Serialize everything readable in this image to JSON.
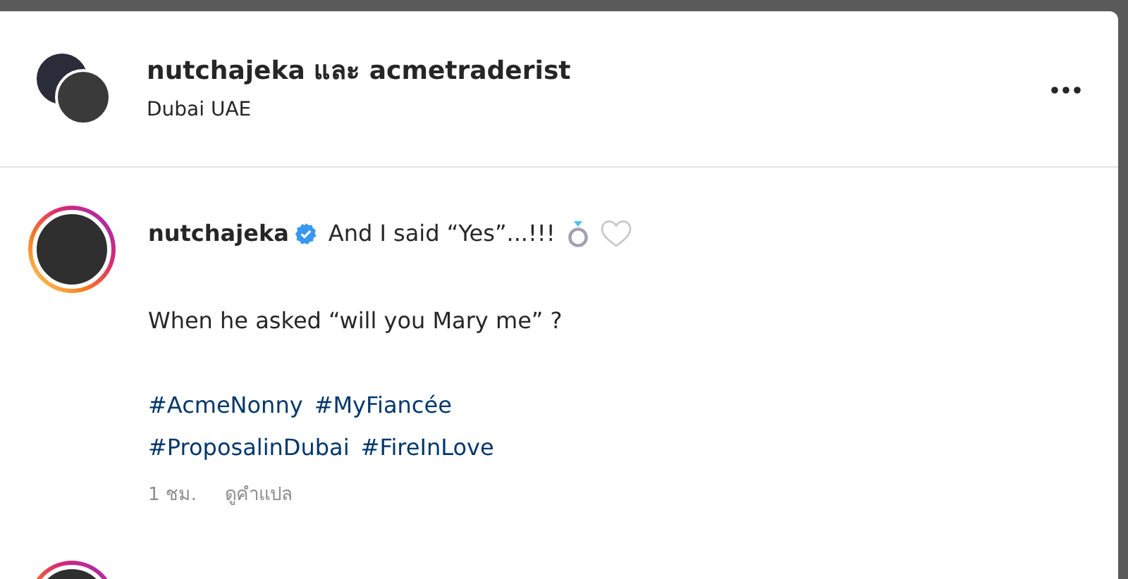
{
  "header": {
    "title": "nutchajeka และ acmetraderist",
    "location": "Dubai UAE"
  },
  "caption": {
    "username": "nutchajeka",
    "verified": true,
    "has_story": true,
    "headline": "And I said “Yes”...!!!",
    "liked": false,
    "body": "When he asked “will you Mary me” ?",
    "hashtag_lines": [
      [
        "#AcmeNonny",
        "#MyFiancée"
      ],
      [
        "#ProposalinDubai",
        "#FireInLove"
      ]
    ],
    "time": "1 ชม.",
    "translate": "ดูคำแปล"
  },
  "next_comment": {
    "has_story": true
  }
}
